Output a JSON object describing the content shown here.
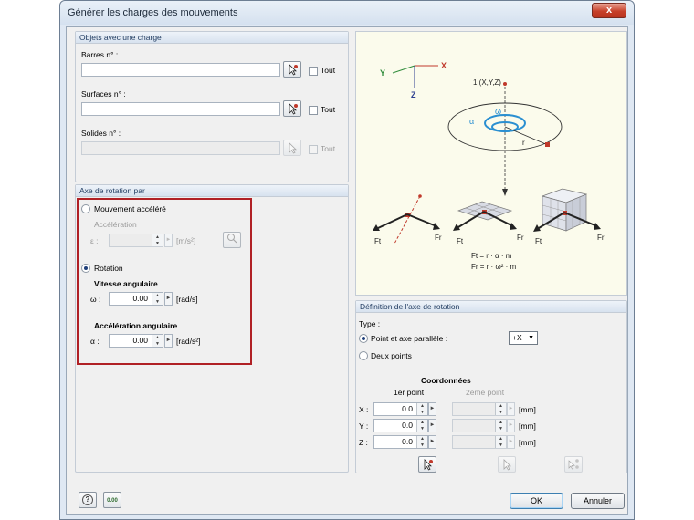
{
  "window": {
    "title": "Générer les charges des mouvements",
    "close_label": "x"
  },
  "objects_group": {
    "title": "Objets avec une charge",
    "bars_label": "Barres n° :",
    "surfaces_label": "Surfaces n° :",
    "solids_label": "Solides n° :",
    "all_label": "Tout"
  },
  "axis_group": {
    "title": "Axe de rotation par",
    "accel_radio": "Mouvement accéléré",
    "accel_sublabel": "Accélération",
    "epsilon_label": "ε :",
    "accel_unit": "[m/s²]",
    "rotation_radio": "Rotation",
    "angular_velocity_title": "Vitesse angulaire",
    "omega_label": "ω :",
    "omega_value": "0.00",
    "omega_unit": "[rad/s]",
    "angular_accel_title": "Accélération angulaire",
    "alpha_label": "α :",
    "alpha_value": "0.00",
    "alpha_unit": "[rad/s²]"
  },
  "diagram": {
    "axis_y": "Y",
    "axis_x": "X",
    "axis_z": "Z",
    "point_label": "1 (X,Y,Z)",
    "omega": "ω",
    "alpha": "α",
    "r": "r",
    "ft": "Ft",
    "fr": "Fr",
    "formula_ft": "Ft = r · α · m",
    "formula_fr": "Fr = r · ω² · m"
  },
  "definition_group": {
    "title": "Définition de l'axe de rotation",
    "type_label": "Type :",
    "point_axis_radio": "Point et axe parallèle :",
    "axis_value": "+X",
    "two_points_radio": "Deux points",
    "coords_title": "Coordonnées",
    "first_point": "1er point",
    "second_point": "2ème point",
    "x_label": "X :",
    "y_label": "Y :",
    "z_label": "Z :",
    "x_value": "0.0",
    "y_value": "0.0",
    "z_value": "0.0",
    "unit": "[mm]"
  },
  "footer": {
    "help_icon": "?",
    "units_icon": "0.00",
    "ok_label": "OK",
    "cancel_label": "Annuler"
  }
}
